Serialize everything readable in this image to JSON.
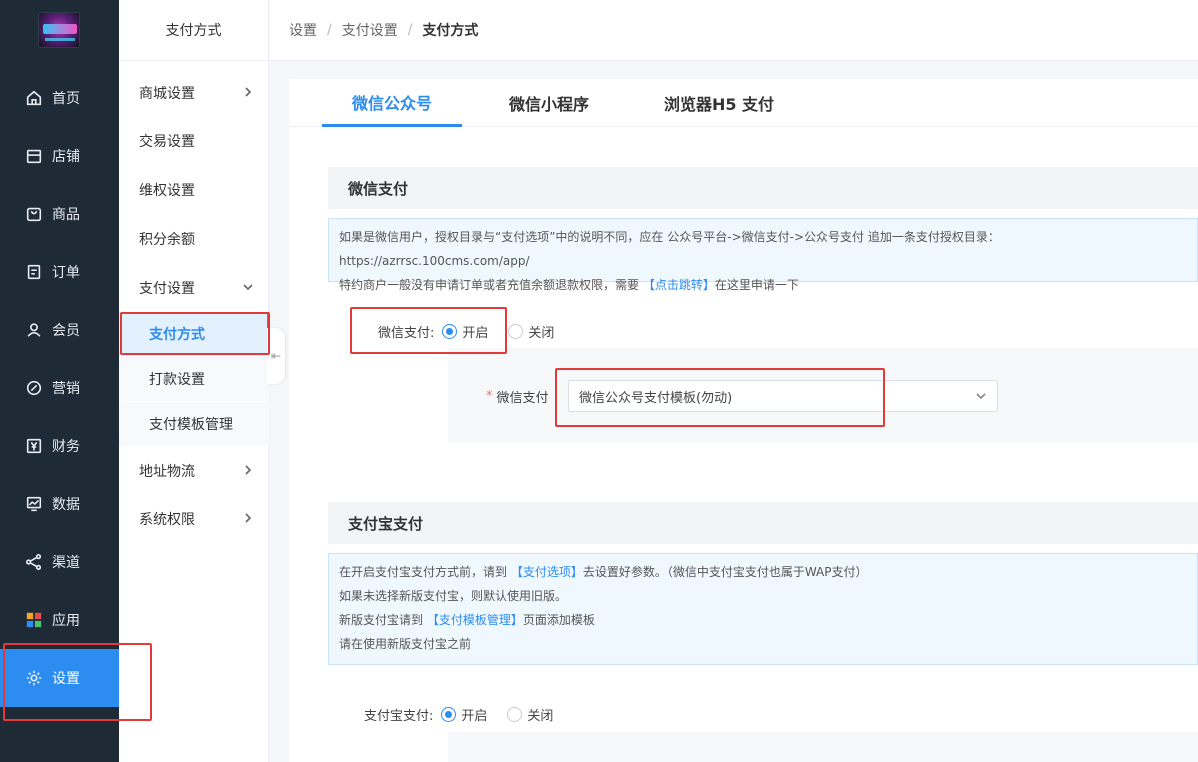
{
  "nav": {
    "items": [
      {
        "label": "首页",
        "icon": "home-icon"
      },
      {
        "label": "店铺",
        "icon": "store-icon"
      },
      {
        "label": "商品",
        "icon": "bag-icon"
      },
      {
        "label": "订单",
        "icon": "order-icon"
      },
      {
        "label": "会员",
        "icon": "user-icon"
      },
      {
        "label": "营销",
        "icon": "marketing-icon"
      },
      {
        "label": "财务",
        "icon": "yen-icon"
      },
      {
        "label": "数据",
        "icon": "chart-icon"
      },
      {
        "label": "渠道",
        "icon": "share-icon"
      },
      {
        "label": "应用",
        "icon": "apps-icon"
      },
      {
        "label": "设置",
        "icon": "gear-icon"
      }
    ]
  },
  "submenu": {
    "title": "支付方式",
    "items": [
      "商城设置",
      "交易设置",
      "维权设置",
      "积分余额",
      "支付设置",
      "地址物流",
      "系统权限"
    ],
    "sub_items": [
      "支付方式",
      "打款设置",
      "支付模板管理"
    ]
  },
  "breadcrumb": [
    "设置",
    "支付设置",
    "支付方式"
  ],
  "tabs": [
    "微信公众号",
    "微信小程序",
    "浏览器H5 支付"
  ],
  "wechat": {
    "title": "微信支付",
    "notice_line1": "如果是微信用户，授权目录与“支付选项”中的说明不同，应在 公众号平台->微信支付->公众号支付 追加一条支付授权目录：https://azrrsc.100cms.com/app/",
    "notice_line2_pre": "特约商户一般没有申请订单或者充值余额退款权限，需要 ",
    "notice_line2_link": "【点击跳转】",
    "notice_line2_post": "在这里申请一下",
    "label": "微信支付:",
    "on": "开启",
    "off": "关闭",
    "select_label": "微信支付",
    "select_value": "微信公众号支付模板(勿动)"
  },
  "alipay": {
    "title": "支付宝支付",
    "n1_pre": "在开启支付宝支付方式前，请到 ",
    "n1_link": "【支付选项】",
    "n1_post": "去设置好参数。（微信中支付宝支付也属于WAP支付）",
    "n2": "如果未选择新版支付宝，则默认使用旧版。",
    "n3_pre": "新版支付宝请到 ",
    "n3_link": "【支付模板管理】",
    "n3_post": "页面添加模板",
    "n4": "请在使用新版支付宝之前",
    "label": "支付宝支付:",
    "on": "开启",
    "off": "关闭"
  }
}
